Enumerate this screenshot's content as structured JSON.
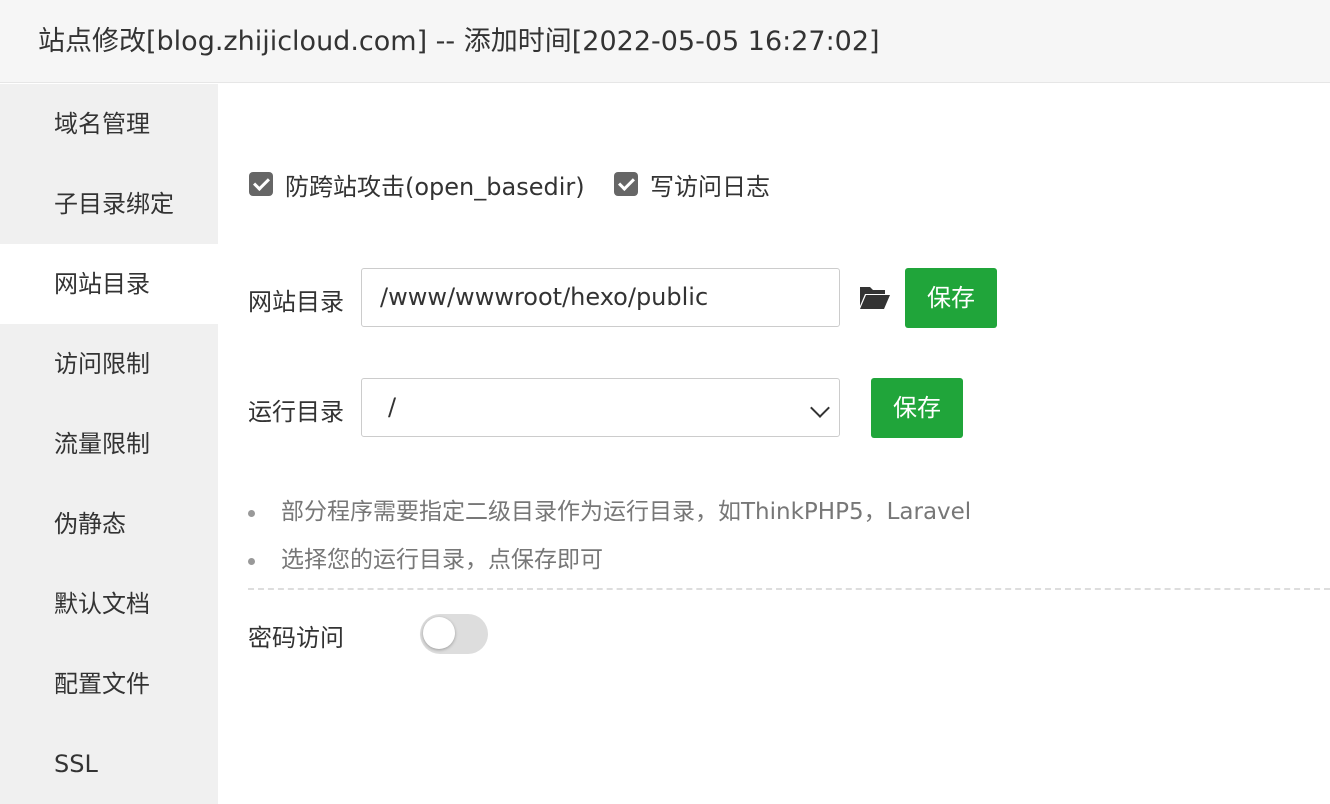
{
  "window": {
    "title": "站点修改[blog.zhijicloud.com] -- 添加时间[2022-05-05 16:27:02]"
  },
  "sidebar": {
    "items": [
      {
        "label": "域名管理",
        "active": false
      },
      {
        "label": "子目录绑定",
        "active": false
      },
      {
        "label": "网站目录",
        "active": true
      },
      {
        "label": "访问限制",
        "active": false
      },
      {
        "label": "流量限制",
        "active": false
      },
      {
        "label": "伪静态",
        "active": false
      },
      {
        "label": "默认文档",
        "active": false
      },
      {
        "label": "配置文件",
        "active": false
      },
      {
        "label": "SSL",
        "active": false
      }
    ]
  },
  "options": {
    "anti_xss": {
      "label": "防跨站攻击(open_basedir)",
      "checked": true
    },
    "access_log": {
      "label": "写访问日志",
      "checked": true
    }
  },
  "site_dir": {
    "label": "网站目录",
    "value": "/www/wwwroot/hexo/public",
    "folder_icon": "folder-open-icon",
    "save_label": "保存"
  },
  "run_dir": {
    "label": "运行目录",
    "selected": "/",
    "save_label": "保存"
  },
  "tips": [
    "部分程序需要指定二级目录作为运行目录，如ThinkPHP5，Laravel",
    "选择您的运行目录，点保存即可"
  ],
  "password_access": {
    "label": "密码访问",
    "enabled": false
  },
  "colors": {
    "primary_button": "#20a53a",
    "sidebar_bg": "#f0f0f0",
    "titlebar_bg": "#f6f6f6",
    "checkbox": "#666666"
  }
}
